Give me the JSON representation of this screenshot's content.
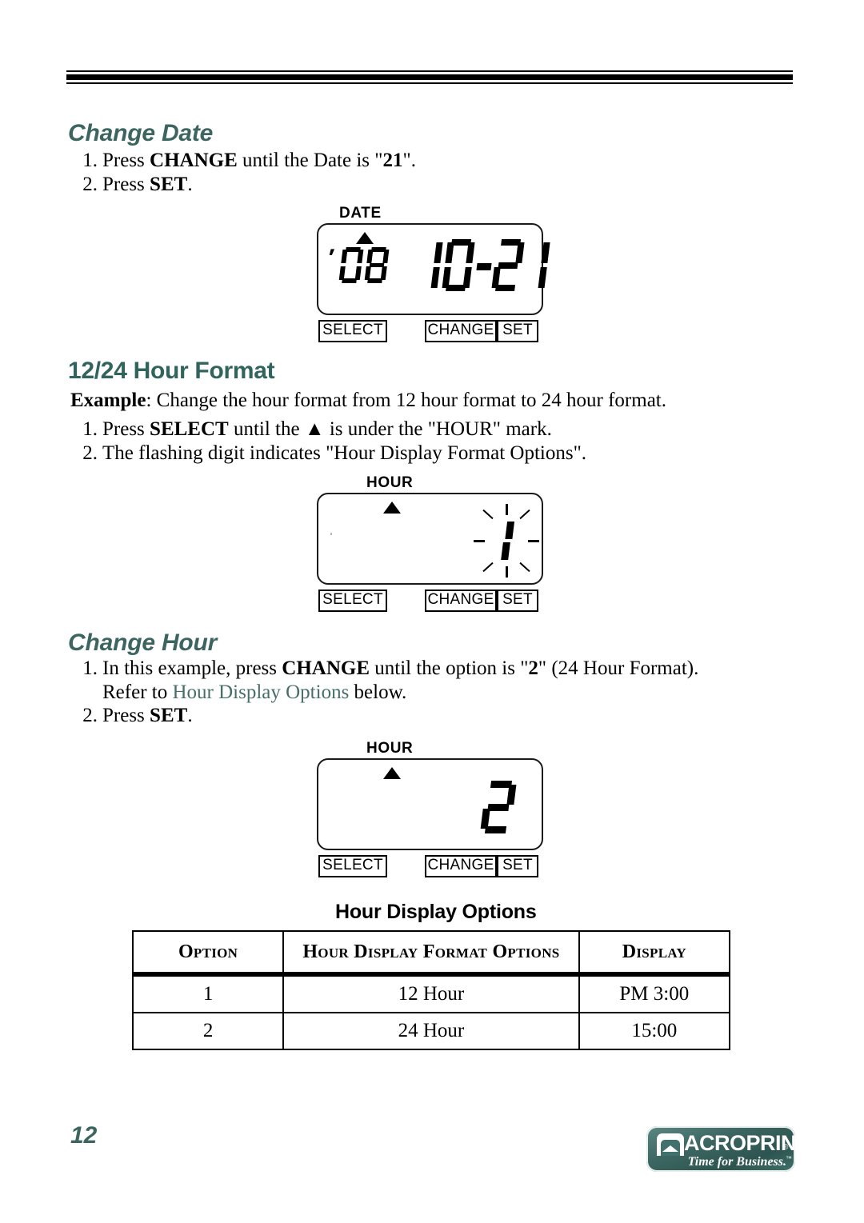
{
  "header": {
    "rules": "triple-rule"
  },
  "sections": [
    {
      "id": "change-date",
      "heading": "Change Date",
      "steps": [
        {
          "num": "1.",
          "parts": [
            {
              "t": "Press ",
              "b": false
            },
            {
              "t": "CHANGE",
              "b": true
            },
            {
              "t": " until the Date is \"",
              "b": false
            },
            {
              "t": "21",
              "b": true
            },
            {
              "t": "\".",
              "b": false
            }
          ]
        },
        {
          "num": "2.",
          "parts": [
            {
              "t": "Press ",
              "b": false
            },
            {
              "t": "SET",
              "b": true
            },
            {
              "t": ".",
              "b": false
            }
          ]
        }
      ]
    },
    {
      "id": "hour-format",
      "heading": "12/24 Hour Format",
      "example_label": "Example",
      "example_text": ": Change the hour format from 12 hour format to 24 hour format.",
      "steps": [
        {
          "num": "1.",
          "parts": [
            {
              "t": "Press ",
              "b": false
            },
            {
              "t": "SELECT",
              "b": true
            },
            {
              "t": " until the ▲ is under the \"HOUR\" mark.",
              "b": false
            }
          ]
        },
        {
          "num": "2.",
          "parts": [
            {
              "t": "The flashing digit indicates \"Hour Display Format Options\".",
              "b": false
            }
          ]
        }
      ]
    },
    {
      "id": "change-hour",
      "heading": "Change Hour",
      "steps": [
        {
          "num": "1.",
          "parts": [
            {
              "t": "In this example, press ",
              "b": false
            },
            {
              "t": "CHANGE",
              "b": true
            },
            {
              "t": " until the option is \"",
              "b": false
            },
            {
              "t": "2",
              "b": true
            },
            {
              "t": "\" (24 Hour Format).",
              "b": false
            }
          ]
        },
        {
          "num": "",
          "parts": [
            {
              "t": "Refer to ",
              "b": false
            },
            {
              "t": "Hour Display Options",
              "b": false,
              "xref": true
            },
            {
              "t": " below.",
              "b": false
            }
          ]
        },
        {
          "num": "2.",
          "parts": [
            {
              "t": "Press ",
              "b": false
            },
            {
              "t": "SET",
              "b": true
            },
            {
              "t": ".",
              "b": false
            }
          ]
        }
      ]
    }
  ],
  "figures": [
    {
      "id": "figure-date",
      "mark_label": "DATE",
      "display_year": "'08",
      "display_value": "10-21",
      "buttons": [
        "SELECT",
        "CHANGE",
        "SET"
      ]
    },
    {
      "id": "figure-hour-flashing",
      "mark_label": "HOUR",
      "display_value": "1",
      "flashing": "true",
      "buttons": [
        "SELECT",
        "CHANGE",
        "SET"
      ]
    },
    {
      "id": "figure-hour-set",
      "mark_label": "HOUR",
      "display_value": "2",
      "flashing": "false",
      "buttons": [
        "SELECT",
        "CHANGE",
        "SET"
      ]
    }
  ],
  "table": {
    "title": "Hour Display Options",
    "headers": [
      "Option",
      "Hour Display Format Options",
      "Display"
    ],
    "rows": [
      [
        "1",
        "12 Hour",
        "PM 3:00"
      ],
      [
        "2",
        "24 Hour",
        "15:00"
      ]
    ]
  },
  "footer": {
    "page_number": "12",
    "logo_name": "ACROPRINT",
    "logo_registered": "®",
    "logo_tagline": "Time for Business.",
    "logo_tm": "™"
  },
  "colors": {
    "heading_teal": "#3c6560",
    "xref_teal": "#466f69",
    "logo_teal": "#3c6661"
  }
}
